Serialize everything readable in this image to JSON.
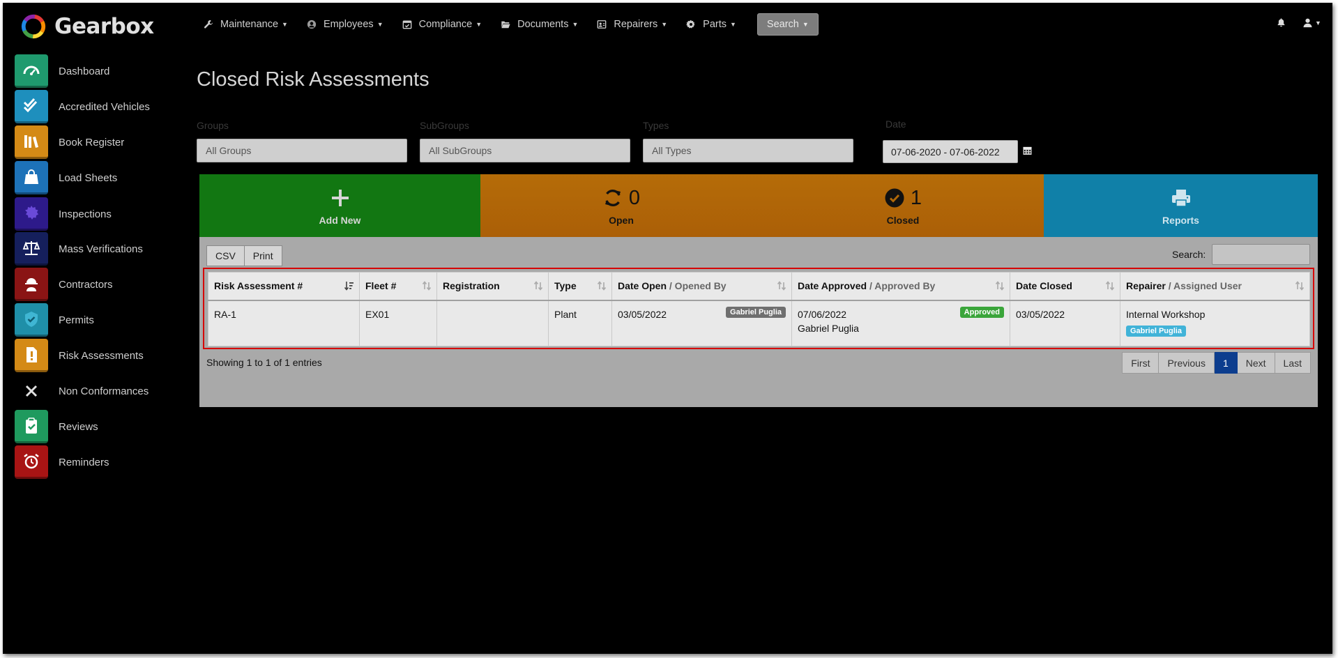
{
  "app": {
    "name": "Gearbox"
  },
  "sidebar": {
    "items": [
      {
        "label": "Dashboard",
        "icon": "speedometer-icon",
        "color": "#1f9a6e"
      },
      {
        "label": "Accredited Vehicles",
        "icon": "double-check-icon",
        "color": "#1e8fbd"
      },
      {
        "label": "Book Register",
        "icon": "books-icon",
        "color": "#d48a16"
      },
      {
        "label": "Load Sheets",
        "icon": "bag-icon",
        "color": "#1d72b8"
      },
      {
        "label": "Inspections",
        "icon": "gear-badge-icon",
        "color": "#2d1a8a"
      },
      {
        "label": "Mass Verifications",
        "icon": "scales-icon",
        "color": "#151f5c"
      },
      {
        "label": "Contractors",
        "icon": "worker-icon",
        "color": "#8a1414"
      },
      {
        "label": "Permits",
        "icon": "shield-check-icon",
        "color": "#1f8fa8"
      },
      {
        "label": "Risk Assessments",
        "icon": "warning-doc-icon",
        "color": "#d48a16"
      },
      {
        "label": "Non Conformances",
        "icon": "x-icon",
        "color": "#000000"
      },
      {
        "label": "Reviews",
        "icon": "clipboard-check-icon",
        "color": "#1f9a5e"
      },
      {
        "label": "Reminders",
        "icon": "alarm-clock-icon",
        "color": "#a81414"
      }
    ]
  },
  "topmenu": {
    "items": [
      {
        "label": "Maintenance",
        "icon": "wrench-icon"
      },
      {
        "label": "Employees",
        "icon": "user-circle-icon"
      },
      {
        "label": "Compliance",
        "icon": "calendar-check-icon"
      },
      {
        "label": "Documents",
        "icon": "folder-open-icon"
      },
      {
        "label": "Repairers",
        "icon": "id-card-icon"
      },
      {
        "label": "Parts",
        "icon": "cog-icon"
      }
    ],
    "search_label": "Search"
  },
  "page": {
    "title": "Closed Risk Assessments"
  },
  "filters": {
    "groups": {
      "label": "Groups",
      "value": "All Groups"
    },
    "subgroups": {
      "label": "SubGroups",
      "value": "All SubGroups"
    },
    "types": {
      "label": "Types",
      "value": "All Types"
    },
    "date": {
      "label": "Date",
      "value": "07-06-2020 - 07-06-2022"
    }
  },
  "tiles": {
    "add_new": {
      "label": "Add New"
    },
    "open": {
      "label": "Open",
      "count": "0"
    },
    "closed": {
      "label": "Closed",
      "count": "1"
    },
    "reports": {
      "label": "Reports"
    }
  },
  "table": {
    "buttons": {
      "csv": "CSV",
      "print": "Print"
    },
    "search_label": "Search:",
    "columns": [
      {
        "main": "Risk Assessment #",
        "sub": ""
      },
      {
        "main": "Fleet #",
        "sub": ""
      },
      {
        "main": "Registration",
        "sub": ""
      },
      {
        "main": "Type",
        "sub": ""
      },
      {
        "main": "Date Open",
        "sub": " / Opened By"
      },
      {
        "main": "Date Approved",
        "sub": " / Approved By"
      },
      {
        "main": "Date Closed",
        "sub": ""
      },
      {
        "main": "Repairer",
        "sub": " / Assigned User"
      }
    ],
    "rows": [
      {
        "ra": "RA-1",
        "fleet": "EX01",
        "registration": "",
        "type": "Plant",
        "date_open": "03/05/2022",
        "opened_by": "Gabriel Puglia",
        "date_approved": "07/06/2022",
        "approved_badge": "Approved",
        "approved_by": "Gabriel Puglia",
        "date_closed": "03/05/2022",
        "repairer": "Internal Workshop",
        "assigned_user": "Gabriel Puglia"
      }
    ],
    "info": "Showing 1 to 1 of 1 entries",
    "pagination": {
      "first": "First",
      "previous": "Previous",
      "current": "1",
      "next": "Next",
      "last": "Last"
    }
  }
}
